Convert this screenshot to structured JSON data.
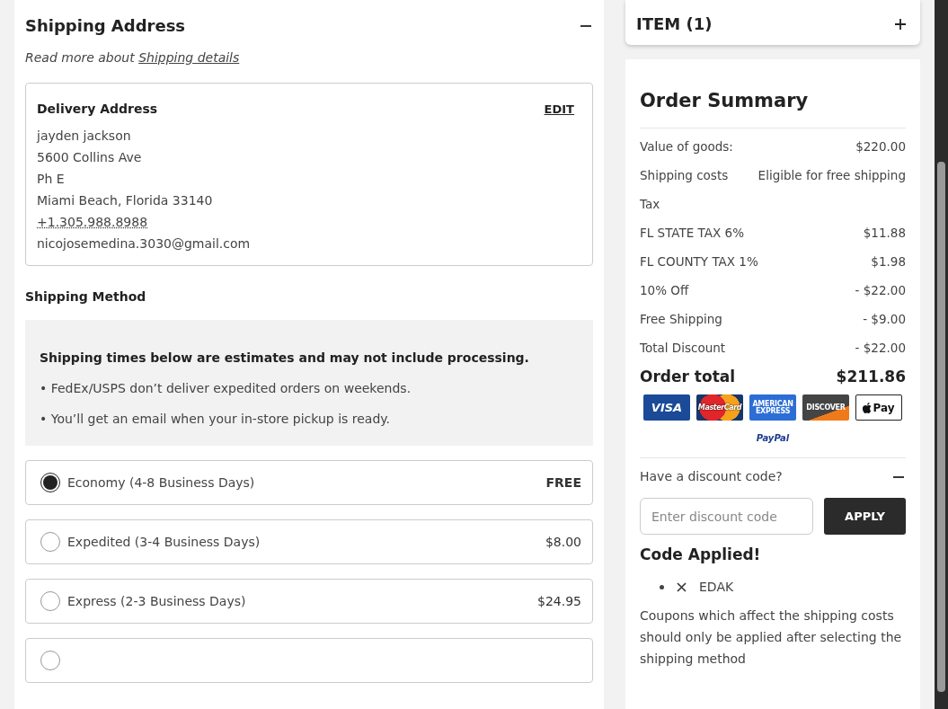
{
  "shipping_address": {
    "title": "Shipping Address",
    "expanded": true,
    "read_more": "Read more about",
    "read_more_link": "Shipping details",
    "delivery": {
      "title": "Delivery Address",
      "edit": "EDIT",
      "lines": [
        {
          "text": "jayden jackson",
          "kind": "plain"
        },
        {
          "text": "5600 Collins Ave",
          "kind": "plain"
        },
        {
          "text": "Ph E",
          "kind": "plain"
        },
        {
          "text": "Miami Beach, Florida 33140",
          "kind": "plain"
        },
        {
          "text": "+1.305.988.8988",
          "kind": "phone"
        },
        {
          "text": "nicojosemedina.3030@gmail.com",
          "kind": "plain"
        }
      ]
    }
  },
  "shipping_method": {
    "title": "Shipping Method",
    "notice_title": "Shipping times below are estimates and may not include processing.",
    "notices": [
      "• FedEx/USPS don’t deliver expedited orders on weekends.",
      "• You’ll get an email when your in-store pickup is ready."
    ],
    "options": [
      {
        "label": "Economy (4-8 Business Days)",
        "price": "FREE",
        "selected": true
      },
      {
        "label": "Expedited (3-4 Business Days)",
        "price": "$8.00",
        "selected": false
      },
      {
        "label": "Express (2-3 Business Days)",
        "price": "$24.95",
        "selected": false
      }
    ],
    "more_options_cut": true
  },
  "items": {
    "title": "ITEM (1)",
    "expanded": false
  },
  "order_summary": {
    "title": "Order Summary",
    "rows": [
      {
        "label": "Value of goods:",
        "value": "$220.00"
      },
      {
        "label": "Shipping costs",
        "value": "Eligible for free shipping"
      },
      {
        "label": "Tax"
      },
      {
        "label": "FL STATE TAX 6%",
        "value": "$11.88"
      },
      {
        "label": "FL COUNTY TAX 1%",
        "value": "$1.98"
      },
      {
        "label": "10% Off",
        "value": "- $22.00"
      },
      {
        "label": "Free Shipping",
        "value": "- $9.00"
      },
      {
        "label": "Total Discount",
        "value": "- $22.00"
      }
    ],
    "total_label": "Order total",
    "total_value": "$211.86",
    "payment_methods": [
      {
        "kind": "visa",
        "label": "VISA"
      },
      {
        "kind": "mastercard",
        "label": "MasterCard"
      },
      {
        "kind": "amex",
        "label": "AMERICAN EXPRESS"
      },
      {
        "kind": "discover",
        "label": "DISCOVER"
      },
      {
        "kind": "applepay",
        "label": "Pay"
      }
    ],
    "paypal": "PayPal",
    "discount": {
      "question": "Have a discount code?",
      "expanded": true,
      "placeholder": "Enter discount code",
      "apply": "APPLY",
      "applied_title": "Code Applied!",
      "codes": [
        "EDAK"
      ],
      "note": "Coupons which affect the shipping costs should only be applied after selecting the shipping method"
    }
  }
}
